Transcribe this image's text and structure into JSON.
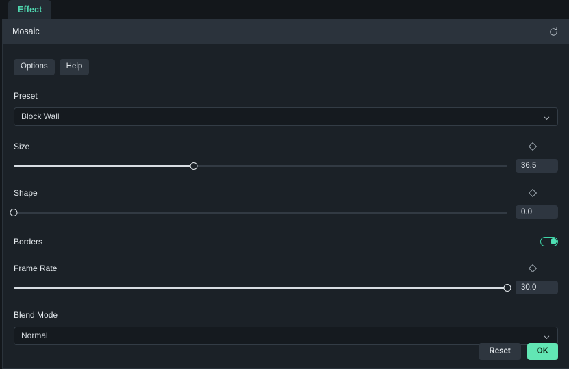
{
  "tab": {
    "label": "Effect"
  },
  "titlebar": {
    "title": "Mosaic",
    "reset_icon": "undo-circular-arrow-icon"
  },
  "toolbar": {
    "options_label": "Options",
    "help_label": "Help"
  },
  "fields": {
    "preset": {
      "label": "Preset",
      "value": "Block Wall",
      "chevron_icon": "chevron-down-icon"
    },
    "size": {
      "label": "Size",
      "value": "36.5",
      "fill_percent": 36.5,
      "keyframe_icon": "diamond-keyframe-icon"
    },
    "shape": {
      "label": "Shape",
      "value": "0.0",
      "fill_percent": 0,
      "keyframe_icon": "diamond-keyframe-icon"
    },
    "borders": {
      "label": "Borders",
      "enabled": true
    },
    "frame_rate": {
      "label": "Frame Rate",
      "value": "30.0",
      "fill_percent": 100,
      "keyframe_icon": "diamond-keyframe-icon"
    },
    "blend_mode": {
      "label": "Blend Mode",
      "value": "Normal",
      "chevron_icon": "chevron-down-icon"
    }
  },
  "footer": {
    "reset_label": "Reset",
    "ok_label": "OK"
  },
  "colors": {
    "accent_green": "#4fd6ae",
    "ok_button": "#62e6b4",
    "panel_bg": "#1b2127",
    "titlebar_bg": "#2b333c"
  }
}
